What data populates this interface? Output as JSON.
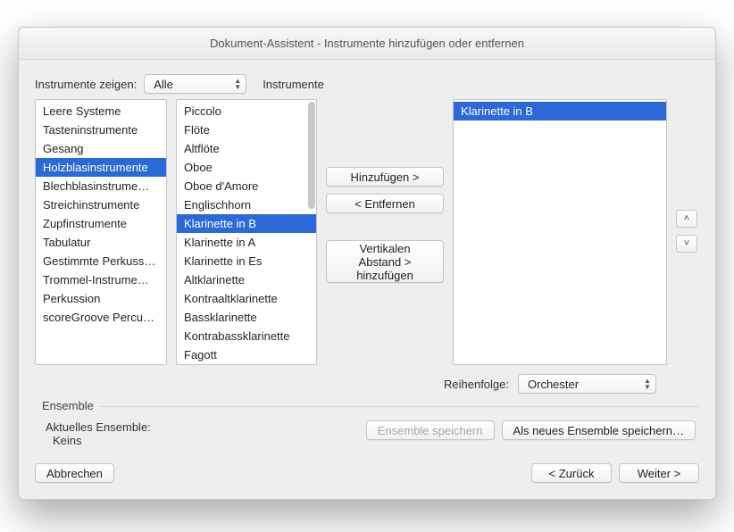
{
  "title": "Dokument-Assistent - Instrumente hinzufügen oder entfernen",
  "labels": {
    "show": "Instrumente zeigen:",
    "instruments": "Instrumente",
    "order": "Reihenfolge:"
  },
  "filter": {
    "value": "Alle"
  },
  "families": {
    "items": [
      "Leere Systeme",
      "Tasteninstrumente",
      "Gesang",
      "Holzblasinstrumente",
      "Blechblasinstrume…",
      "Streichinstrumente",
      "Zupfinstrumente",
      "Tabulatur",
      "Gestimmte Perkuss…",
      "Trommel-Instrume…",
      "Perkussion",
      "scoreGroove Percu…"
    ],
    "selectedIndex": 3
  },
  "instruments": {
    "items": [
      "Piccolo",
      "Flöte",
      "Altflöte",
      "Oboe",
      "Oboe d'Amore",
      "Englischhorn",
      "Klarinette in B",
      "Klarinette in A",
      "Klarinette in Es",
      "Altklarinette",
      "Kontraaltklarinette",
      "Bassklarinette",
      "Kontrabassklarinette",
      "Fagott"
    ],
    "selectedIndex": 6
  },
  "added": {
    "items": [
      "Klarinette in B"
    ],
    "selectedIndex": 0
  },
  "midButtons": {
    "add": "Hinzufügen >",
    "remove": "< Entfernen",
    "spacer": "Vertikalen Abstand > hinzufügen"
  },
  "orderSelect": {
    "value": "Orchester"
  },
  "ensemble": {
    "legend": "Ensemble",
    "currentLabel": "Aktuelles Ensemble:",
    "currentValue": "Keins",
    "saveBtn": "Ensemble speichern",
    "saveAsBtn": "Als neues Ensemble speichern…"
  },
  "footer": {
    "cancel": "Abbrechen",
    "back": "< Zurück",
    "next": "Weiter >"
  }
}
